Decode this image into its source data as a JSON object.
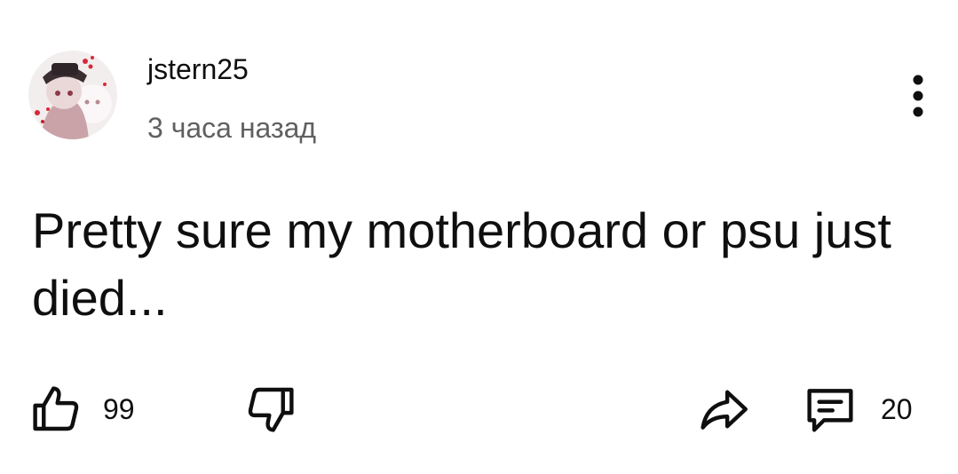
{
  "post": {
    "author": "jstern25",
    "timestamp": "3 часа назад",
    "text": "Pretty sure my motherboard or psu just died..."
  },
  "actions": {
    "likes": "99",
    "comments": "20"
  },
  "colors": {
    "text_primary": "#0f0f0f",
    "text_secondary": "#606060",
    "background": "#ffffff"
  },
  "icons": {
    "more": "more-vertical-icon",
    "like": "thumb-up-icon",
    "dislike": "thumb-down-icon",
    "share": "share-arrow-icon",
    "comment": "comment-icon"
  }
}
